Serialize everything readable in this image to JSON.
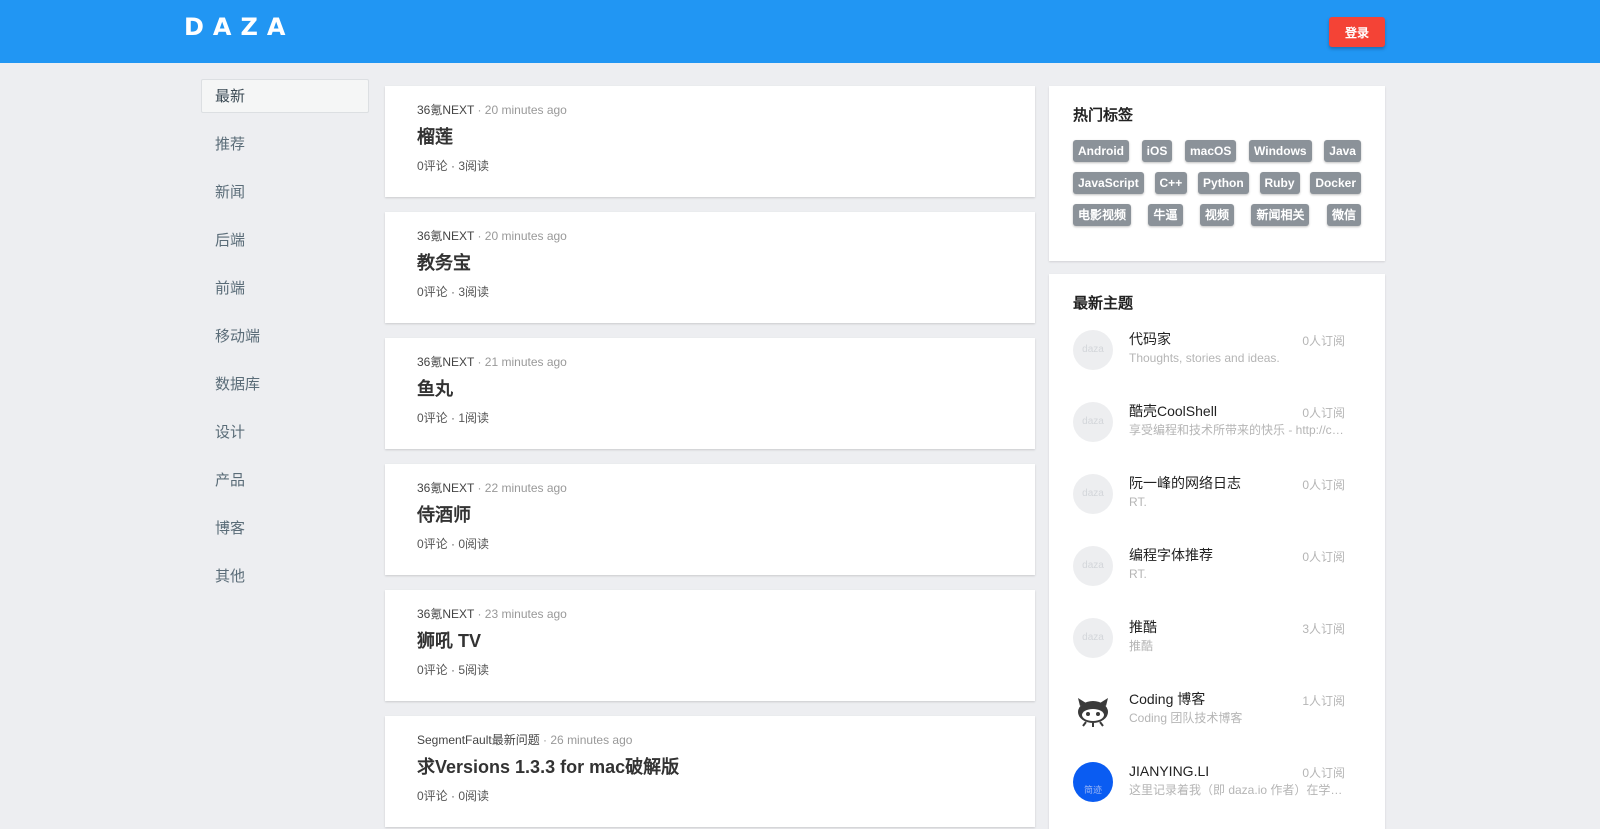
{
  "header": {
    "logo": "DAZA",
    "login_label": "登录"
  },
  "sidebar": {
    "items": [
      {
        "label": "最新",
        "active": true
      },
      {
        "label": "推荐",
        "active": false
      },
      {
        "label": "新闻",
        "active": false
      },
      {
        "label": "后端",
        "active": false
      },
      {
        "label": "前端",
        "active": false
      },
      {
        "label": "移动端",
        "active": false
      },
      {
        "label": "数据库",
        "active": false
      },
      {
        "label": "设计",
        "active": false
      },
      {
        "label": "产品",
        "active": false
      },
      {
        "label": "博客",
        "active": false
      },
      {
        "label": "其他",
        "active": false
      }
    ]
  },
  "feed": {
    "posts": [
      {
        "source": "36氪NEXT",
        "time": " · 20 minutes ago",
        "title": "榴莲",
        "stats": "0评论 · 3阅读"
      },
      {
        "source": "36氪NEXT",
        "time": " · 20 minutes ago",
        "title": "教务宝",
        "stats": "0评论 · 3阅读"
      },
      {
        "source": "36氪NEXT",
        "time": " · 21 minutes ago",
        "title": "鱼丸",
        "stats": "0评论 · 1阅读"
      },
      {
        "source": "36氪NEXT",
        "time": " · 22 minutes ago",
        "title": "侍酒师",
        "stats": "0评论 · 0阅读"
      },
      {
        "source": "36氪NEXT",
        "time": " · 23 minutes ago",
        "title": "狮吼 TV",
        "stats": "0评论 · 5阅读"
      },
      {
        "source": "SegmentFault最新问题",
        "time": " · 26 minutes ago",
        "title": "求Versions 1.3.3 for mac破解版",
        "stats": "0评论 · 0阅读"
      }
    ]
  },
  "tags_panel": {
    "title": "热门标签",
    "rows": [
      [
        "Android",
        "iOS",
        "macOS",
        "Windows",
        "Java"
      ],
      [
        "JavaScript",
        "C++",
        "Python",
        "Ruby",
        "Docker"
      ],
      [
        "电影视频",
        "牛逼",
        "视频",
        "新闻相关",
        "微信"
      ]
    ]
  },
  "topics_panel": {
    "title": "最新主题",
    "topics": [
      {
        "name": "代码家",
        "desc": "Thoughts, stories and ideas.",
        "subs": "0人订阅",
        "avatar_text": "daza",
        "avatar": "placeholder"
      },
      {
        "name": "酷壳CoolShell",
        "desc": "享受编程和技术所带来的快乐 - http://coolshell.cn",
        "subs": "0人订阅",
        "avatar_text": "daza",
        "avatar": "placeholder"
      },
      {
        "name": "阮一峰的网络日志",
        "desc": "RT.",
        "subs": "0人订阅",
        "avatar_text": "daza",
        "avatar": "placeholder"
      },
      {
        "name": "编程字体推荐",
        "desc": "RT.",
        "subs": "0人订阅",
        "avatar_text": "daza",
        "avatar": "placeholder"
      },
      {
        "name": "推酷",
        "desc": "推酷",
        "subs": "3人订阅",
        "avatar_text": "daza",
        "avatar": "placeholder"
      },
      {
        "name": "Coding 博客",
        "desc": "Coding 团队技术博客",
        "subs": "1人订阅",
        "avatar_text": "",
        "avatar": "octocat-icon"
      },
      {
        "name": "JIANYING.LI",
        "desc": "这里记录着我（即 daza.io 作者）在学习过程中的点滴",
        "subs": "0人订阅",
        "avatar_text": "简迹",
        "avatar": "blue"
      }
    ]
  },
  "colors": {
    "header_bg": "#2196f3",
    "login_btn": "#f44336",
    "tag_bg": "#8b9299",
    "page_bg": "#edeef1"
  }
}
